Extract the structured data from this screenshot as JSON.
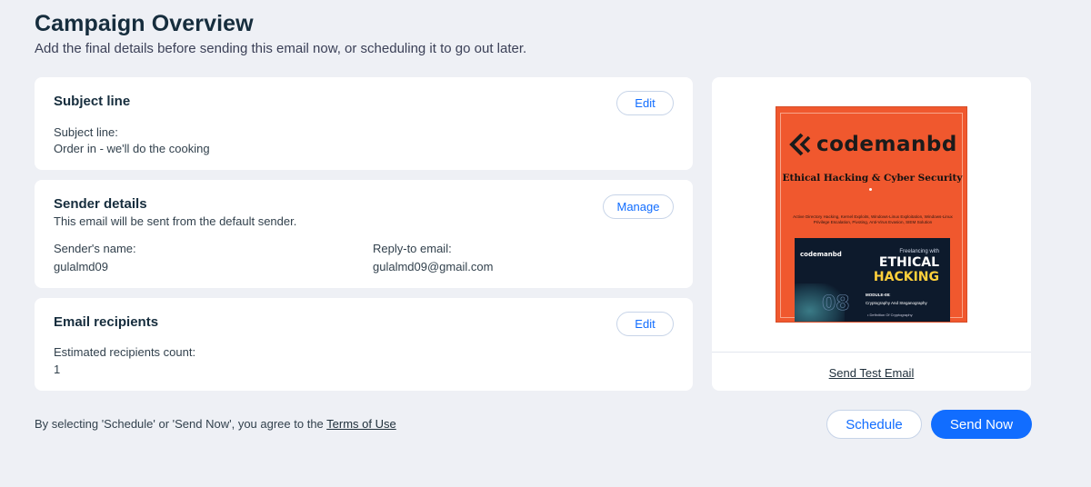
{
  "header": {
    "title": "Campaign Overview",
    "subtitle": "Add the final details before sending this email now, or scheduling it to go out later."
  },
  "subject_card": {
    "title": "Subject line",
    "edit_label": "Edit",
    "field_label": "Subject line:",
    "field_value": "Order in - we'll do the cooking"
  },
  "sender_card": {
    "title": "Sender details",
    "description": "This email will be sent from the default sender.",
    "manage_label": "Manage",
    "name_label": "Sender's name:",
    "name_value": "gulalmd09",
    "reply_label": "Reply-to email:",
    "reply_value": "gulalmd09@gmail.com"
  },
  "recipients_card": {
    "title": "Email recipients",
    "edit_label": "Edit",
    "count_label": "Estimated recipients count:",
    "count_value": "1"
  },
  "preview": {
    "logo_text": "codemanbd",
    "headline": "Ethical Hacking & Cyber Security",
    "description": "Active Directory Hacking, Kernel Exploits, Windows-Linux Exploitation, Windows-Linux Privilege Escalation, Pivoting, Anti-Virus Evasion, SIEM Solution",
    "panel_logo": "codemanbd",
    "panel_tagline": "Freelancing with",
    "panel_word1": "ETHICAL",
    "panel_word2": "HACKING",
    "panel_module": "MODULE-08:",
    "panel_module_title": "Cryptography And Steganography",
    "panel_bullet": "• Definition Of Cryptography",
    "panel_number": "08",
    "send_test_label": "Send Test Email"
  },
  "footer": {
    "agreement_text": "By selecting 'Schedule' or 'Send Now', you agree to the ",
    "terms_label": "Terms of Use",
    "schedule_label": "Schedule",
    "send_now_label": "Send Now"
  },
  "colors": {
    "accent": "#116dff",
    "background": "#eef0f5",
    "preview_orange": "#f0582e"
  }
}
